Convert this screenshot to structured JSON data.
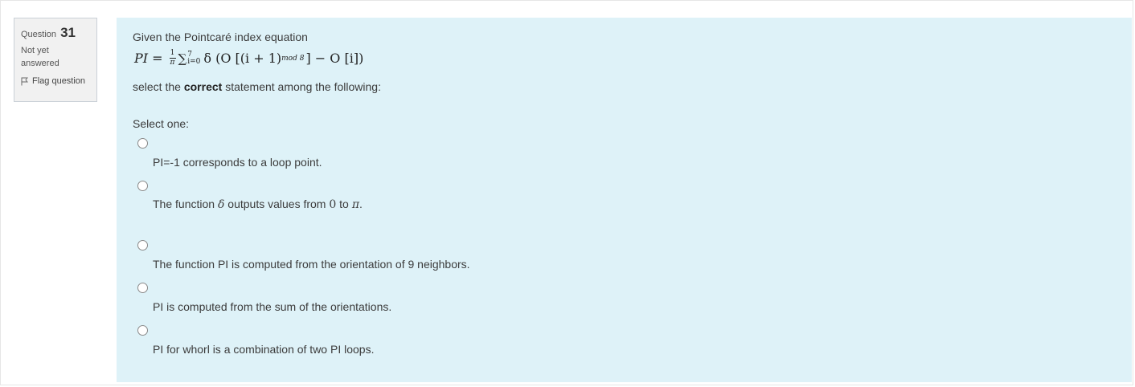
{
  "question": {
    "label": "Question",
    "number": "31",
    "state": "Not yet answered",
    "flag_label": "Flag question"
  },
  "content": {
    "prompt": "Given the Pointcaré index equation",
    "formula": {
      "lhs": "PI",
      "equals": "=",
      "frac_num": "1",
      "frac_den": "π",
      "sum_symbol": "∑",
      "sum_upper": "7",
      "sum_lower": "i=0",
      "body_start": "δ (O [(i + 1)",
      "subscript": "mod 8",
      "body_end": "] − O [i])"
    },
    "instruction_prefix": "select the",
    "instruction_bold": "correct",
    "instruction_suffix": "statement among the following:",
    "select_one": "Select one:"
  },
  "options": [
    {
      "text": "PI=-1 corresponds to a loop point."
    },
    {
      "text_a": "The function",
      "sym_delta": "δ",
      "text_b": "outputs values from",
      "sym_zero": "0",
      "text_c": "to",
      "sym_pi": "π",
      "text_d": "."
    },
    {
      "text": "The function PI is computed from the orientation of 9 neighbors."
    },
    {
      "text": "PI is computed from the sum of the orientations."
    },
    {
      "text": "PI for whorl is a combination of two PI loops."
    }
  ]
}
